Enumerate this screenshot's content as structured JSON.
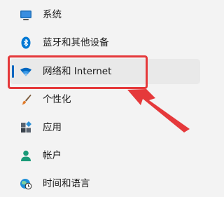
{
  "nav": {
    "items": [
      {
        "label": "系统",
        "icon": "monitor-icon"
      },
      {
        "label": "蓝牙和其他设备",
        "icon": "bluetooth-icon"
      },
      {
        "label": "网络和 Internet",
        "icon": "wifi-icon",
        "selected": true
      },
      {
        "label": "个性化",
        "icon": "paintbrush-icon"
      },
      {
        "label": "应用",
        "icon": "apps-icon"
      },
      {
        "label": "帐户",
        "icon": "person-icon"
      },
      {
        "label": "时间和语言",
        "icon": "clock-globe-icon"
      }
    ]
  },
  "colors": {
    "accent": "#0067c0",
    "annotation": "#e5393b",
    "background": "#f3f3f3",
    "selected_bg": "#e9e9e9"
  }
}
